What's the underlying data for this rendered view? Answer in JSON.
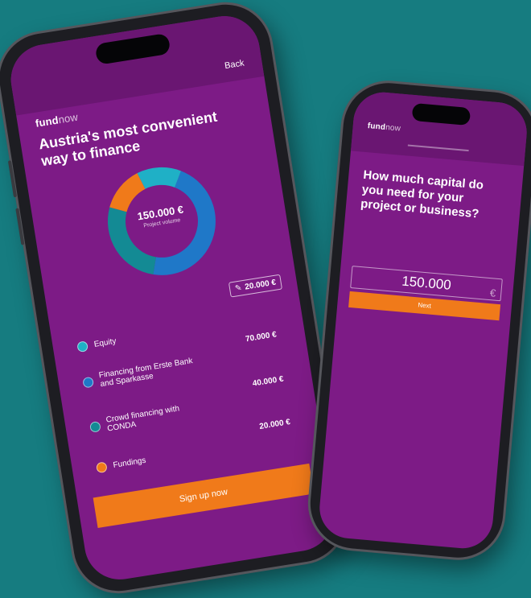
{
  "left_phone": {
    "nav": {
      "back_label": "Back"
    },
    "brand": {
      "bold": "fund",
      "lite": "now"
    },
    "headline": "Austria's most convenient way to finance",
    "donut": {
      "center_value": "150.000 €",
      "center_caption": "Project volume",
      "segments": [
        {
          "name": "Financing from Erste Bank and Sparkasse",
          "share": 0.4667,
          "color": "#1f78c8"
        },
        {
          "name": "Crowd financing with CONDA",
          "share": 0.2667,
          "color": "#138a94"
        },
        {
          "name": "Fundings",
          "share": 0.1333,
          "color": "#f07a1a"
        },
        {
          "name": "Equity",
          "share": 0.1333,
          "color": "#1fb0c6"
        }
      ]
    },
    "edit_amount": "20.000 €",
    "legend": [
      {
        "label": "Equity",
        "color": "#1fb0c6",
        "amount": ""
      },
      {
        "label": "Financing from Erste Bank and Sparkasse",
        "color": "#1f78c8",
        "amount": "70.000 €"
      },
      {
        "label": "Crowd financing with CONDA",
        "color": "#138a94",
        "amount": "40.000 €"
      },
      {
        "label": "Fundings",
        "color": "#f07a1a",
        "amount": "20.000 €"
      }
    ],
    "cta_label": "Sign up now"
  },
  "right_phone": {
    "brand": {
      "bold": "fund",
      "lite": "now"
    },
    "question": "How much capital do you need for your project or business?",
    "input_value": "150.000",
    "currency": "€",
    "next_label": "Next"
  },
  "colors": {
    "background": "#167c80",
    "screen": "#7d1b86",
    "accent": "#f07a1a"
  }
}
